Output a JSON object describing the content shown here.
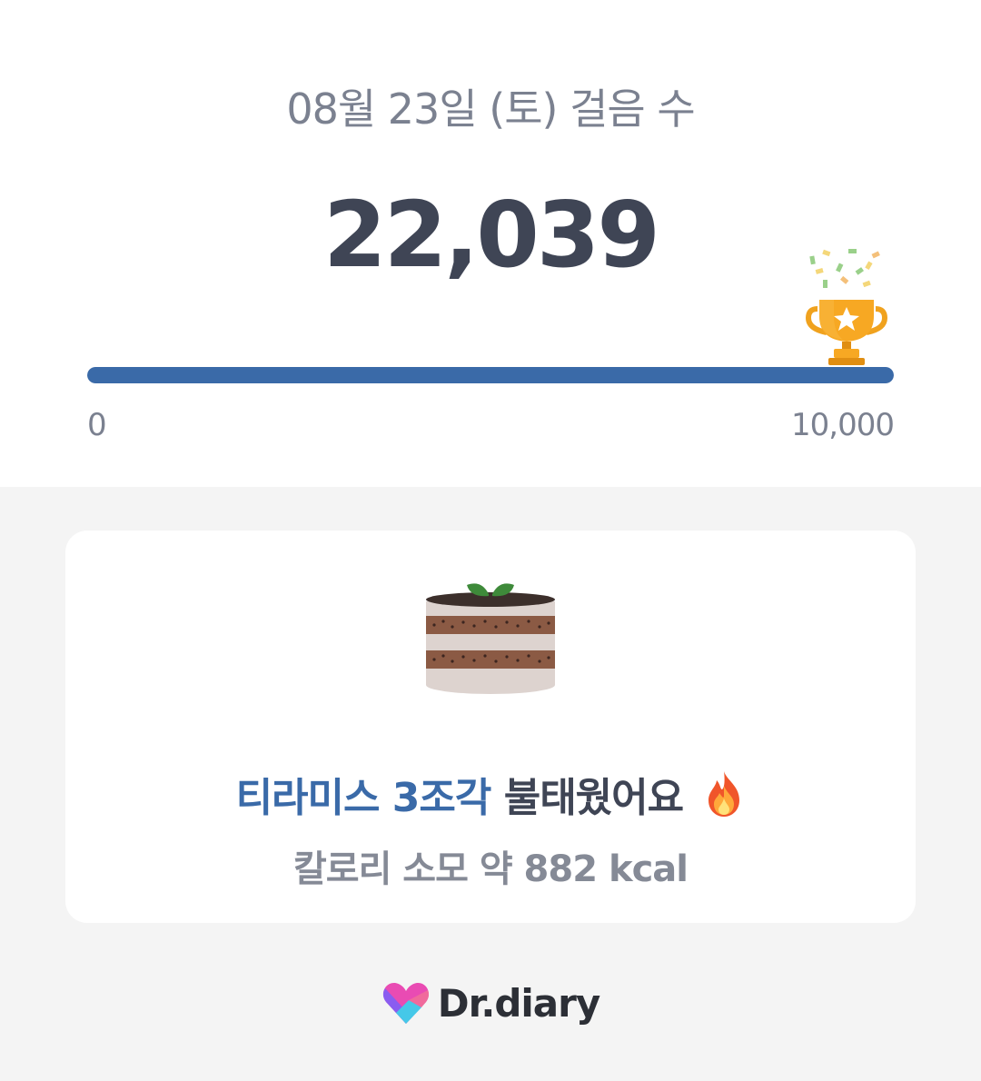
{
  "header": {
    "date_title": "08월 23일 (토) 걸음 수",
    "step_count": "22,039"
  },
  "progress": {
    "min_label": "0",
    "max_label": "10,000",
    "fill_fraction": 1.0,
    "color": "#3a6aa8"
  },
  "trophy_icon": "trophy-icon",
  "card": {
    "food_icon": "tiramisu-cake-icon",
    "highlight_text": "티라미스 3조각",
    "rest_text": " 불태웠어요",
    "emoji_icon": "fire-icon",
    "calorie_text": "칼로리 소모 약 882 kcal"
  },
  "brand": {
    "logo_icon": "heart-logo-icon",
    "name": "Dr.diary"
  },
  "colors": {
    "accent": "#3a6aa8",
    "primary_text": "#3f4555",
    "secondary_text": "#7b8190",
    "background": "#f4f4f4"
  }
}
